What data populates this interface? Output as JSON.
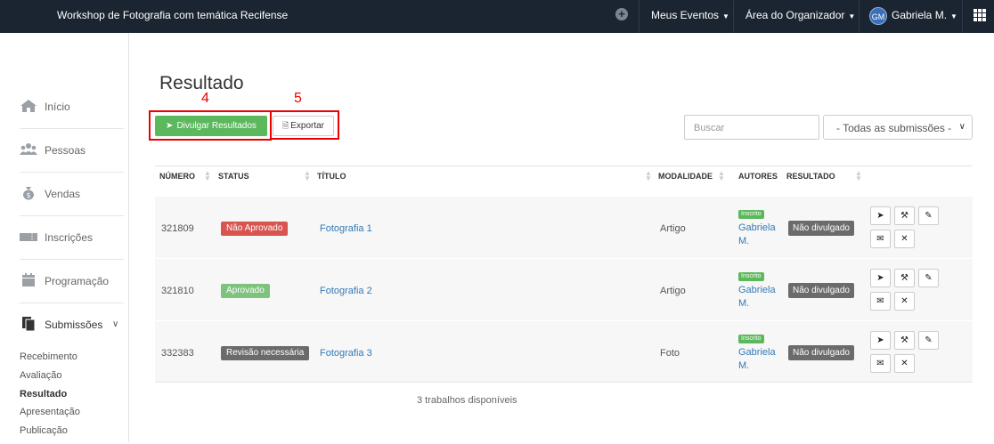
{
  "topbar": {
    "title": "Workshop de Fotografia com temática Recifense",
    "nav_events": "Meus Eventos",
    "nav_organizer": "Área do Organizador",
    "user_initials": "GM",
    "user_name": "Gabriela M."
  },
  "sidebar": {
    "items": [
      {
        "label": "Início",
        "icon": "home-icon"
      },
      {
        "label": "Pessoas",
        "icon": "people-icon"
      },
      {
        "label": "Vendas",
        "icon": "money-bag-icon"
      },
      {
        "label": "Inscrições",
        "icon": "ticket-icon"
      },
      {
        "label": "Programação",
        "icon": "calendar-icon"
      },
      {
        "label": "Submissões",
        "icon": "documents-icon"
      }
    ],
    "subitems": [
      "Recebimento",
      "Avaliação",
      "Resultado",
      "Apresentação",
      "Publicação"
    ],
    "current_subitem": "Resultado"
  },
  "main": {
    "title": "Resultado",
    "annotation_4": "4",
    "annotation_5": "5",
    "publish_button": "Divulgar Resultados",
    "export_button": "Exportar",
    "search_placeholder": "Buscar",
    "filter_value": "- Todas as submissões -"
  },
  "table": {
    "headers": [
      "NÚMERO",
      "STATUS",
      "TÍTULO",
      "MODALIDADE",
      "AUTORES",
      "RESULTADO"
    ],
    "rows": [
      {
        "number": "321809",
        "status": "Não Aprovado",
        "status_color": "#d9534f",
        "title": "Fotografia 1",
        "modality": "Artigo",
        "badge": "Inscrito",
        "author_line1": "Gabriela",
        "author_line2": "M.",
        "result": "Não divulgado"
      },
      {
        "number": "321810",
        "status": "Aprovado",
        "status_color": "#7dc27d",
        "title": "Fotografia 2",
        "modality": "Artigo",
        "badge": "Inscrito",
        "author_line1": "Gabriela",
        "author_line2": "M.",
        "result": "Não divulgado"
      },
      {
        "number": "332383",
        "status": "Revisão necessária",
        "status_color": "#6b6b6b",
        "title": "Fotografia 3",
        "modality": "Foto",
        "badge": "Inscrito",
        "author_line1": "Gabriela",
        "author_line2": "M.",
        "result": "Não divulgado"
      }
    ],
    "footer": "3 trabalhos disponíveis"
  }
}
